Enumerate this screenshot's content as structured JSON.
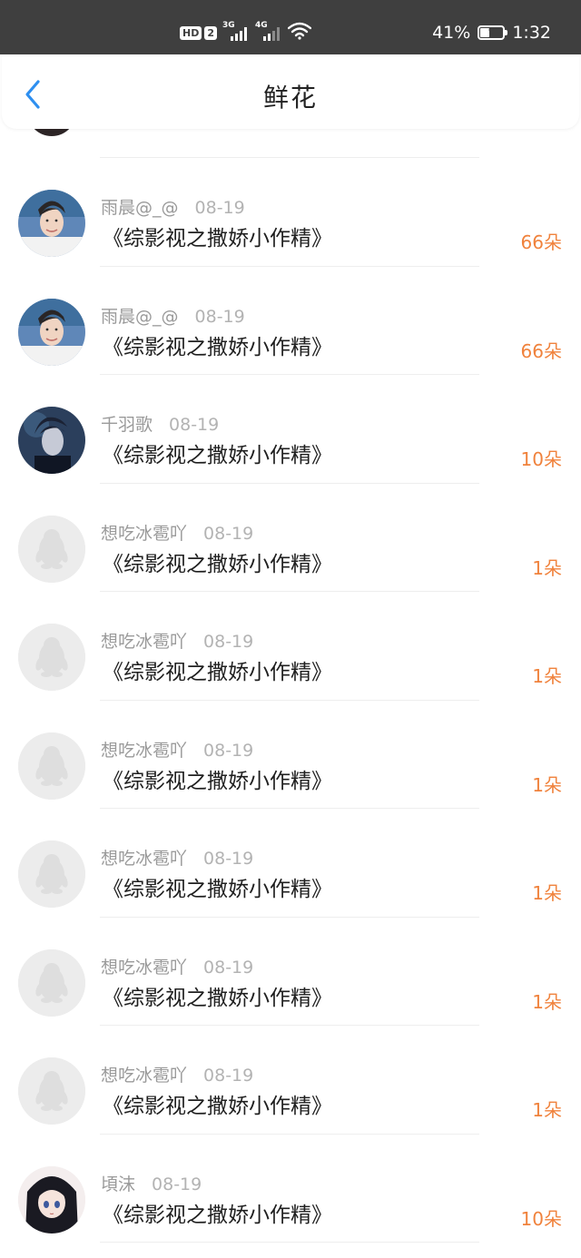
{
  "status_bar": {
    "hd": "HD",
    "sim": "2",
    "net1": "3G",
    "net2": "4G",
    "battery_percent": "41%",
    "time": "1:32"
  },
  "header": {
    "title": "鲜花",
    "back_icon": "chevron-left-icon"
  },
  "accent_color": "#f0823c",
  "back_color": "#2e8ff0",
  "rows": [
    {
      "user": "雨晨@_@",
      "date": "08-19",
      "book": "《综影视之撒娇小作精》",
      "count": "66朵",
      "avatar": "photo-young-man"
    },
    {
      "user": "雨晨@_@",
      "date": "08-19",
      "book": "《综影视之撒娇小作精》",
      "count": "66朵",
      "avatar": "photo-young-man"
    },
    {
      "user": "千羽歌",
      "date": "08-19",
      "book": "《综影视之撒娇小作精》",
      "count": "10朵",
      "avatar": "photo-dark-blue"
    },
    {
      "user": "想吃冰雹吖",
      "date": "08-19",
      "book": "《综影视之撒娇小作精》",
      "count": "1朵",
      "avatar": "default-penguin"
    },
    {
      "user": "想吃冰雹吖",
      "date": "08-19",
      "book": "《综影视之撒娇小作精》",
      "count": "1朵",
      "avatar": "default-penguin"
    },
    {
      "user": "想吃冰雹吖",
      "date": "08-19",
      "book": "《综影视之撒娇小作精》",
      "count": "1朵",
      "avatar": "default-penguin"
    },
    {
      "user": "想吃冰雹吖",
      "date": "08-19",
      "book": "《综影视之撒娇小作精》",
      "count": "1朵",
      "avatar": "default-penguin"
    },
    {
      "user": "想吃冰雹吖",
      "date": "08-19",
      "book": "《综影视之撒娇小作精》",
      "count": "1朵",
      "avatar": "default-penguin"
    },
    {
      "user": "想吃冰雹吖",
      "date": "08-19",
      "book": "《综影视之撒娇小作精》",
      "count": "1朵",
      "avatar": "default-penguin"
    },
    {
      "user": "頃沫",
      "date": "08-19",
      "book": "《综影视之撒娇小作精》",
      "count": "10朵",
      "avatar": "anime-girl"
    }
  ]
}
